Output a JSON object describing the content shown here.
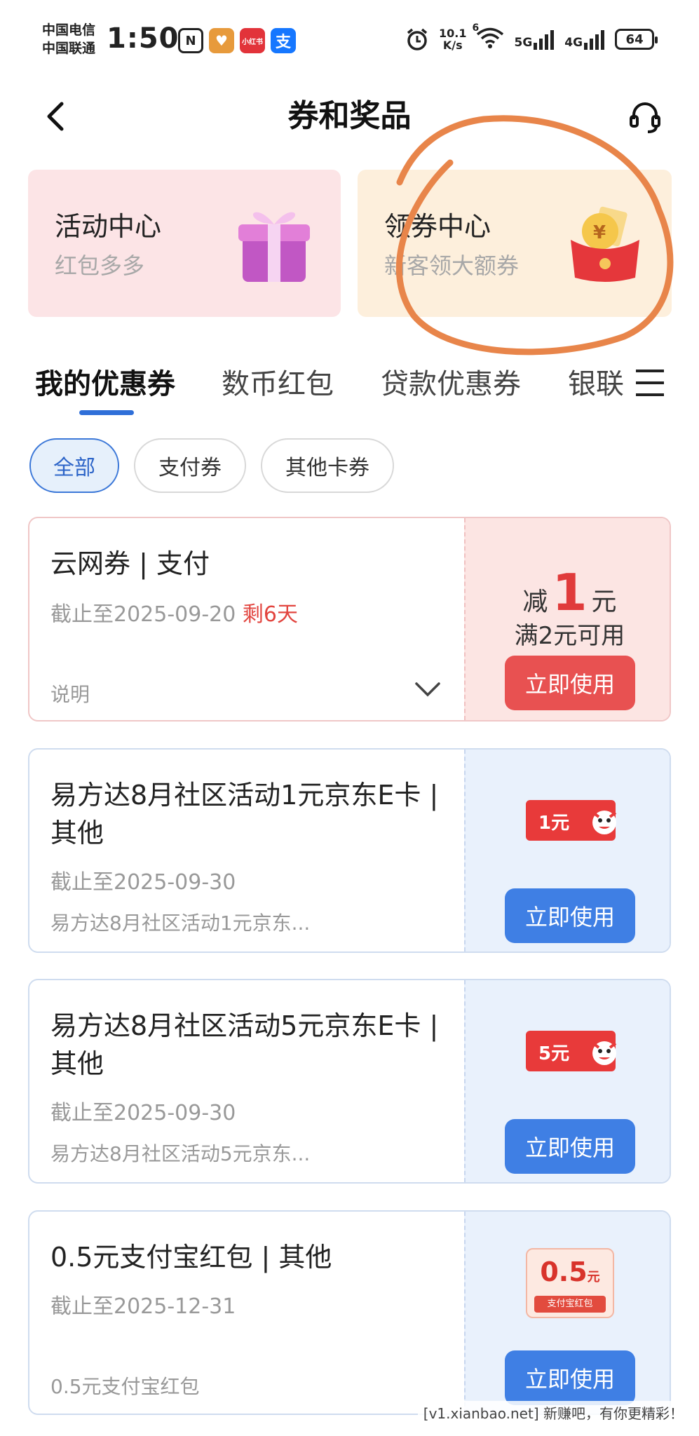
{
  "status_bar": {
    "carrier_1": "中国电信",
    "carrier_2": "中国联通",
    "time": "1:50",
    "apps": [
      "N",
      "♥",
      "小红书",
      "支"
    ],
    "net_speed_value": "10.1",
    "net_speed_unit": "K/s",
    "wifi_badge": "6",
    "signal_1": "5G",
    "signal_2": "4G",
    "battery": "64"
  },
  "header": {
    "title": "券和奖品"
  },
  "promos": [
    {
      "title": "活动中心",
      "subtitle": "红包多多"
    },
    {
      "title": "领券中心",
      "subtitle": "新客领大额券"
    }
  ],
  "tabs": [
    "我的优惠券",
    "数币红包",
    "贷款优惠券",
    "银联"
  ],
  "active_tab": 0,
  "filters": [
    "全部",
    "支付券",
    "其他卡券"
  ],
  "active_filter": 0,
  "coupons": [
    {
      "title": "云网券 | 支付",
      "deadline": "截止至2025-09-20",
      "remaining": "剩6天",
      "desc": "说明",
      "amount_prefix": "减",
      "amount": "1",
      "amount_unit": "元",
      "condition": "满2元可用",
      "button": "立即使用"
    },
    {
      "title": "易方达8月社区活动1元京东E卡 | 其他",
      "deadline": "截止至2025-09-30",
      "desc": "易方达8月社区活动1元京东...",
      "card_value": "1元",
      "button": "立即使用"
    },
    {
      "title": "易方达8月社区活动5元京东E卡 | 其他",
      "deadline": "截止至2025-09-30",
      "desc": "易方达8月社区活动5元京东...",
      "card_value": "5元",
      "button": "立即使用"
    },
    {
      "title": "0.5元支付宝红包 | 其他",
      "deadline": "截止至2025-12-31",
      "desc": "0.5元支付宝红包",
      "card_amount": "0.5",
      "card_unit": "元",
      "card_label": "支付宝红包",
      "button": "立即使用"
    }
  ],
  "watermark": "[v1.xianbao.net] 新赚吧，有你更精彩！",
  "colors": {
    "accent_blue": "#3f7fe4",
    "accent_red": "#e85151",
    "annotation_orange": "#e8854a"
  }
}
